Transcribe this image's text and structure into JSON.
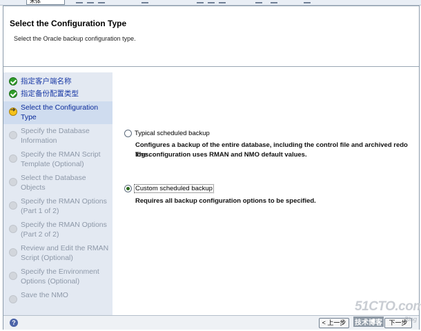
{
  "toolbar": {
    "font_combo": "宋体"
  },
  "header": {
    "title": "Select the Configuration Type",
    "subtitle": "Select the Oracle backup configuration type."
  },
  "steps": [
    {
      "label": "指定客户端名称",
      "state": "done"
    },
    {
      "label": "指定备份配置类型",
      "state": "done"
    },
    {
      "label": "Select the Configuration Type",
      "state": "current"
    },
    {
      "label": "Specify the Database Information",
      "state": "pending"
    },
    {
      "label": "Specify the RMAN Script Template (Optional)",
      "state": "pending"
    },
    {
      "label": "Select the Database Objects",
      "state": "pending"
    },
    {
      "label": "Specify the RMAN Options (Part 1 of 2)",
      "state": "pending"
    },
    {
      "label": "Specify the RMAN Options (Part 2 of 2)",
      "state": "pending"
    },
    {
      "label": "Review and Edit the RMAN Script (Optional)",
      "state": "pending"
    },
    {
      "label": "Specify the Environment Options (Optional)",
      "state": "pending"
    },
    {
      "label": "Save the NMO",
      "state": "pending"
    }
  ],
  "options": {
    "typical": {
      "label": "Typical scheduled backup",
      "desc_line1": "Configures a backup of the entire database, including the control file and archived redo logs.",
      "desc_line2": "The configuration uses RMAN and NMO default values.",
      "selected": false
    },
    "custom": {
      "label": "Custom scheduled backup",
      "desc_line1": "Requires all backup configuration options to be specified.",
      "selected": true
    }
  },
  "footer": {
    "help_icon": "?",
    "back_label": "< 上一步",
    "next_label": "下一步"
  },
  "watermark": {
    "site": "51CTO.com",
    "text": "技术博客",
    "blog": "Blog"
  },
  "colors": {
    "steps_bg": "#e3e9f2",
    "current_step_bg": "#cfdcef",
    "done_icon": "#2f9e2a",
    "current_icon": "#f6c21a",
    "pending_text": "#8d98a8",
    "link_text": "#1a3aa6"
  }
}
